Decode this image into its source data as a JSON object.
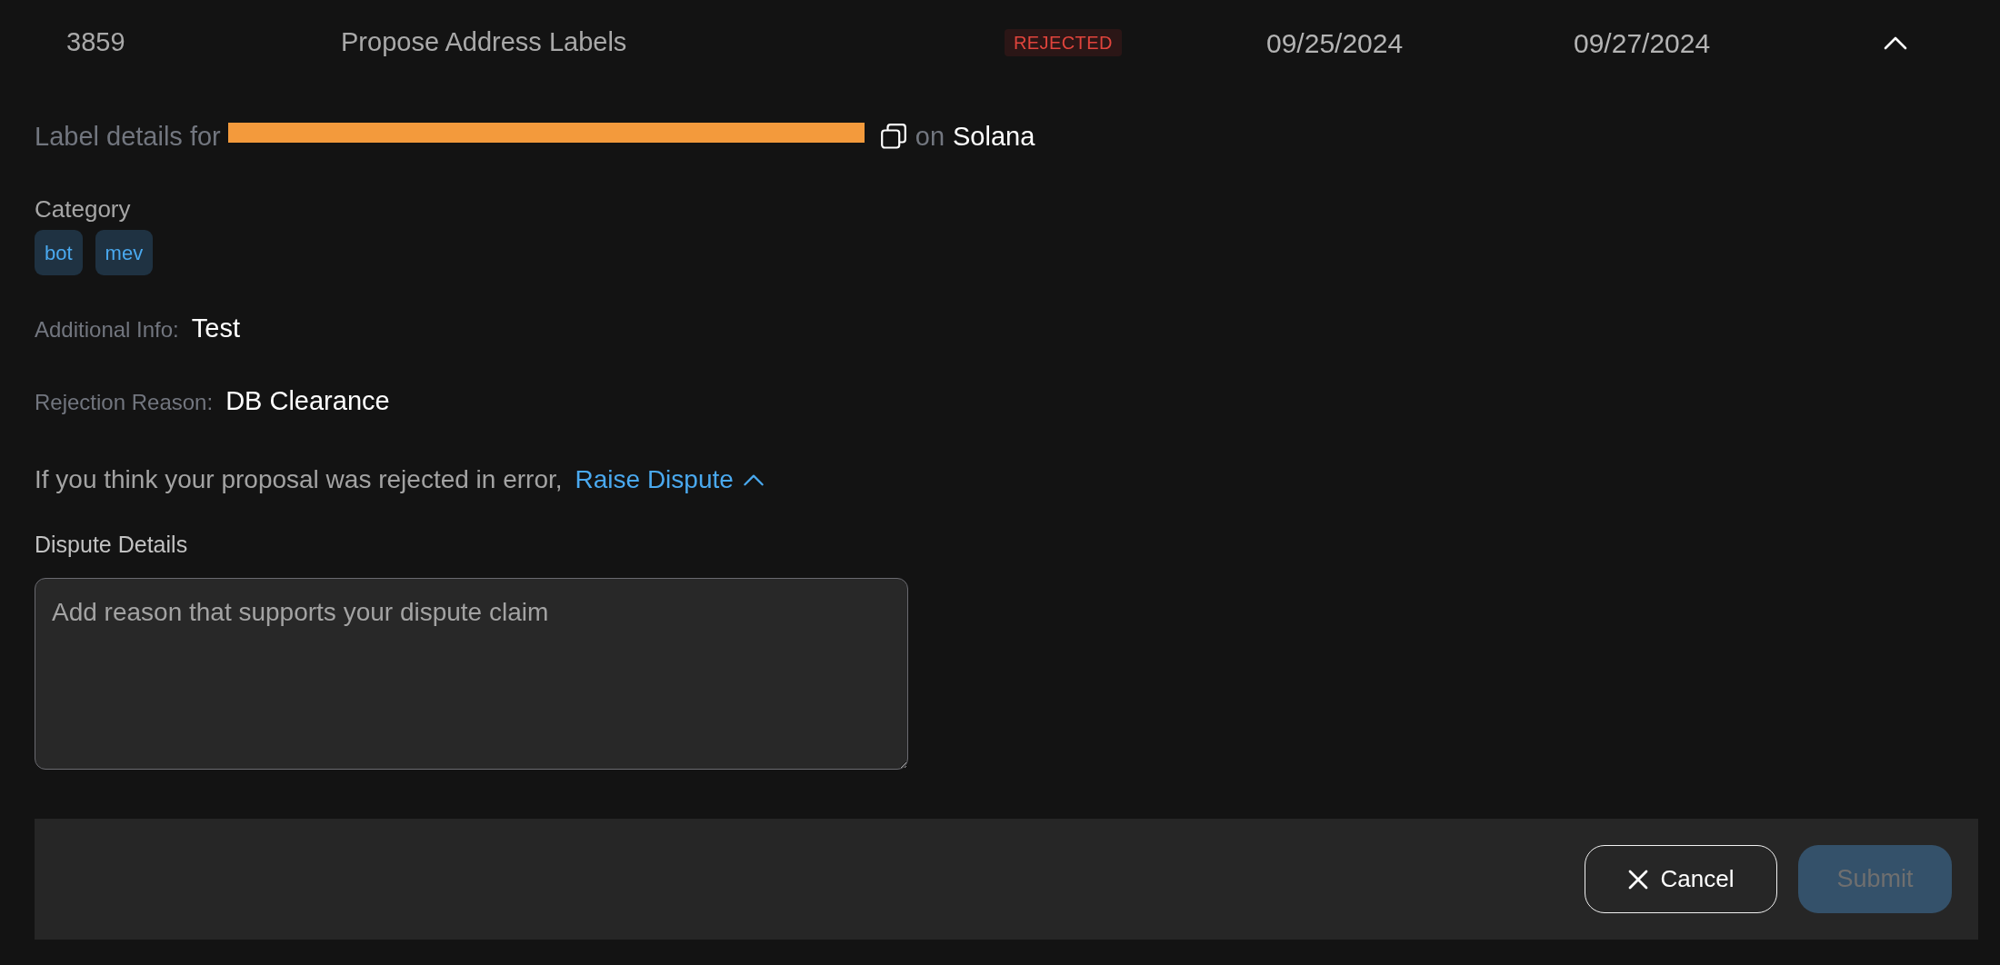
{
  "row": {
    "number": "3859",
    "title": "Propose Address Labels",
    "status": {
      "text": "REJECTED",
      "kind": "rejected"
    },
    "date_1": "09/25/2024",
    "date_2": "09/27/2024",
    "expanded": true
  },
  "details": {
    "intro": "Label details for",
    "address_redacted": true,
    "network_prefix": "on",
    "network": "Solana",
    "category_label": "Category",
    "categories": [
      "bot",
      "mev"
    ],
    "fields": [
      {
        "label": "Additional Info:",
        "value": "Test"
      },
      {
        "label": "Rejection Reason:",
        "value": "DB Clearance"
      }
    ]
  },
  "dispute": {
    "prompt": "If you think your proposal was rejected in error,",
    "link": "Raise Dispute",
    "expanded": true,
    "details_label": "Dispute Details",
    "placeholder": "Add reason that supports your dispute claim"
  },
  "actions": {
    "cancel": "Cancel",
    "submit": "Submit",
    "submit_disabled": true
  }
}
